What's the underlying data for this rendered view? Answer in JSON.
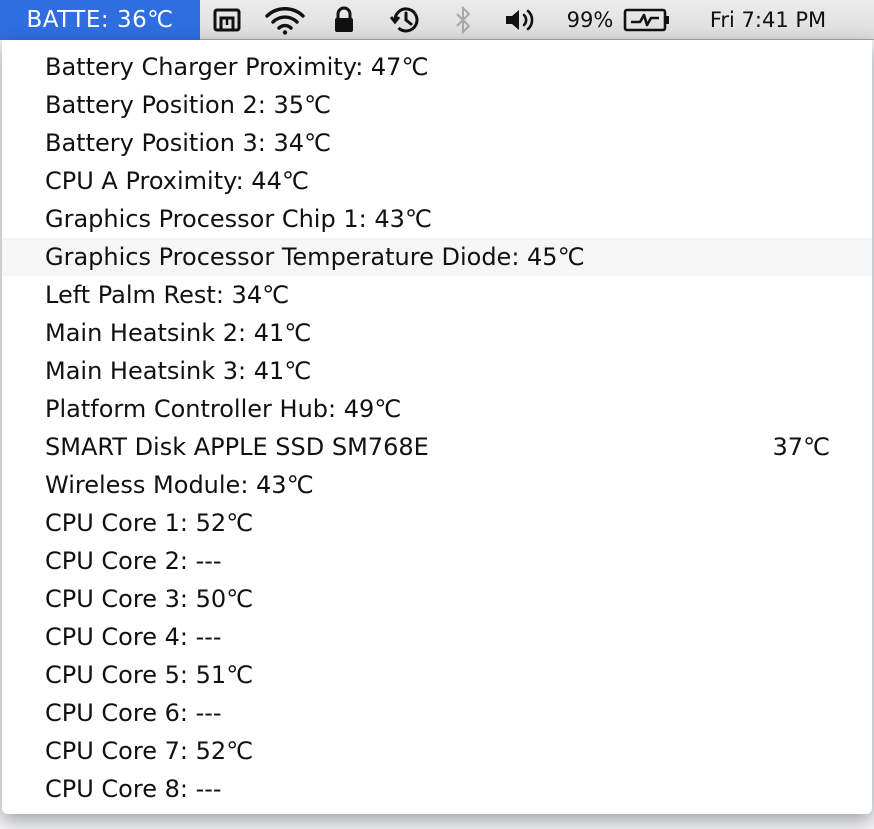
{
  "menubar": {
    "sensor_title": "BATTE: 36℃",
    "icons": [
      "menu-extra-app-icon",
      "wifi-icon",
      "lock-icon",
      "time-machine-icon",
      "bluetooth-icon",
      "volume-icon",
      "battery-charging-icon"
    ],
    "battery_percent": "99%",
    "clock": "Fri 7:41 PM",
    "accent_color": "#2f6ee0"
  },
  "menu": {
    "rows": [
      {
        "label": "Battery Charger Proximity: 47℃"
      },
      {
        "label": "Battery Position 2: 35℃"
      },
      {
        "label": "Battery Position 3: 34℃"
      },
      {
        "label": "CPU A Proximity: 44℃"
      },
      {
        "label": "Graphics Processor Chip 1: 43℃"
      },
      {
        "label": "Graphics Processor Temperature Diode: 45℃"
      },
      {
        "label": "Left Palm Rest: 34℃"
      },
      {
        "label": "Main Heatsink 2: 41℃"
      },
      {
        "label": "Main Heatsink 3: 41℃"
      },
      {
        "label": "Platform Controller Hub: 49℃"
      },
      {
        "label": "SMART Disk APPLE SSD SM768E",
        "value": "37℃"
      },
      {
        "label": "Wireless Module: 43℃"
      },
      {
        "label": "CPU Core 1: 52℃"
      },
      {
        "label": "CPU Core 2: ---"
      },
      {
        "label": "CPU Core 3: 50℃"
      },
      {
        "label": "CPU Core 4: ---"
      },
      {
        "label": "CPU Core 5: 51℃"
      },
      {
        "label": "CPU Core 6: ---"
      },
      {
        "label": "CPU Core 7: 52℃"
      },
      {
        "label": "CPU Core 8: ---"
      }
    ]
  }
}
